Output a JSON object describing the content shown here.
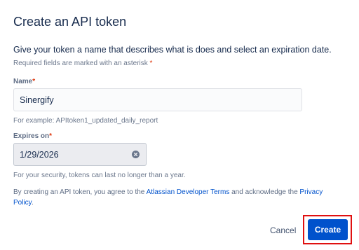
{
  "dialog": {
    "title": "Create an API token",
    "description": "Give your token a name that describes what is does and select an expiration date.",
    "required_note": "Required fields are marked with an asterisk",
    "required_marker": "*"
  },
  "name_field": {
    "label": "Name",
    "value": "Sinergify",
    "hint": "For example: APItoken1_updated_daily_report"
  },
  "expires_field": {
    "label": "Expires on",
    "value": "1/29/2026",
    "hint": "For your security, tokens can last no longer than a year.",
    "clear_icon": "clear-circle-x-icon"
  },
  "terms": {
    "prefix": "By creating an API token, you agree to the ",
    "link1": "Atlassian Developer Terms",
    "middle": " and acknowledge the ",
    "link2": "Privacy Policy",
    "suffix": "."
  },
  "actions": {
    "cancel_label": "Cancel",
    "create_label": "Create"
  },
  "colors": {
    "primary": "#0052cc",
    "required": "#de350b",
    "highlight_outline": "#e01010"
  }
}
